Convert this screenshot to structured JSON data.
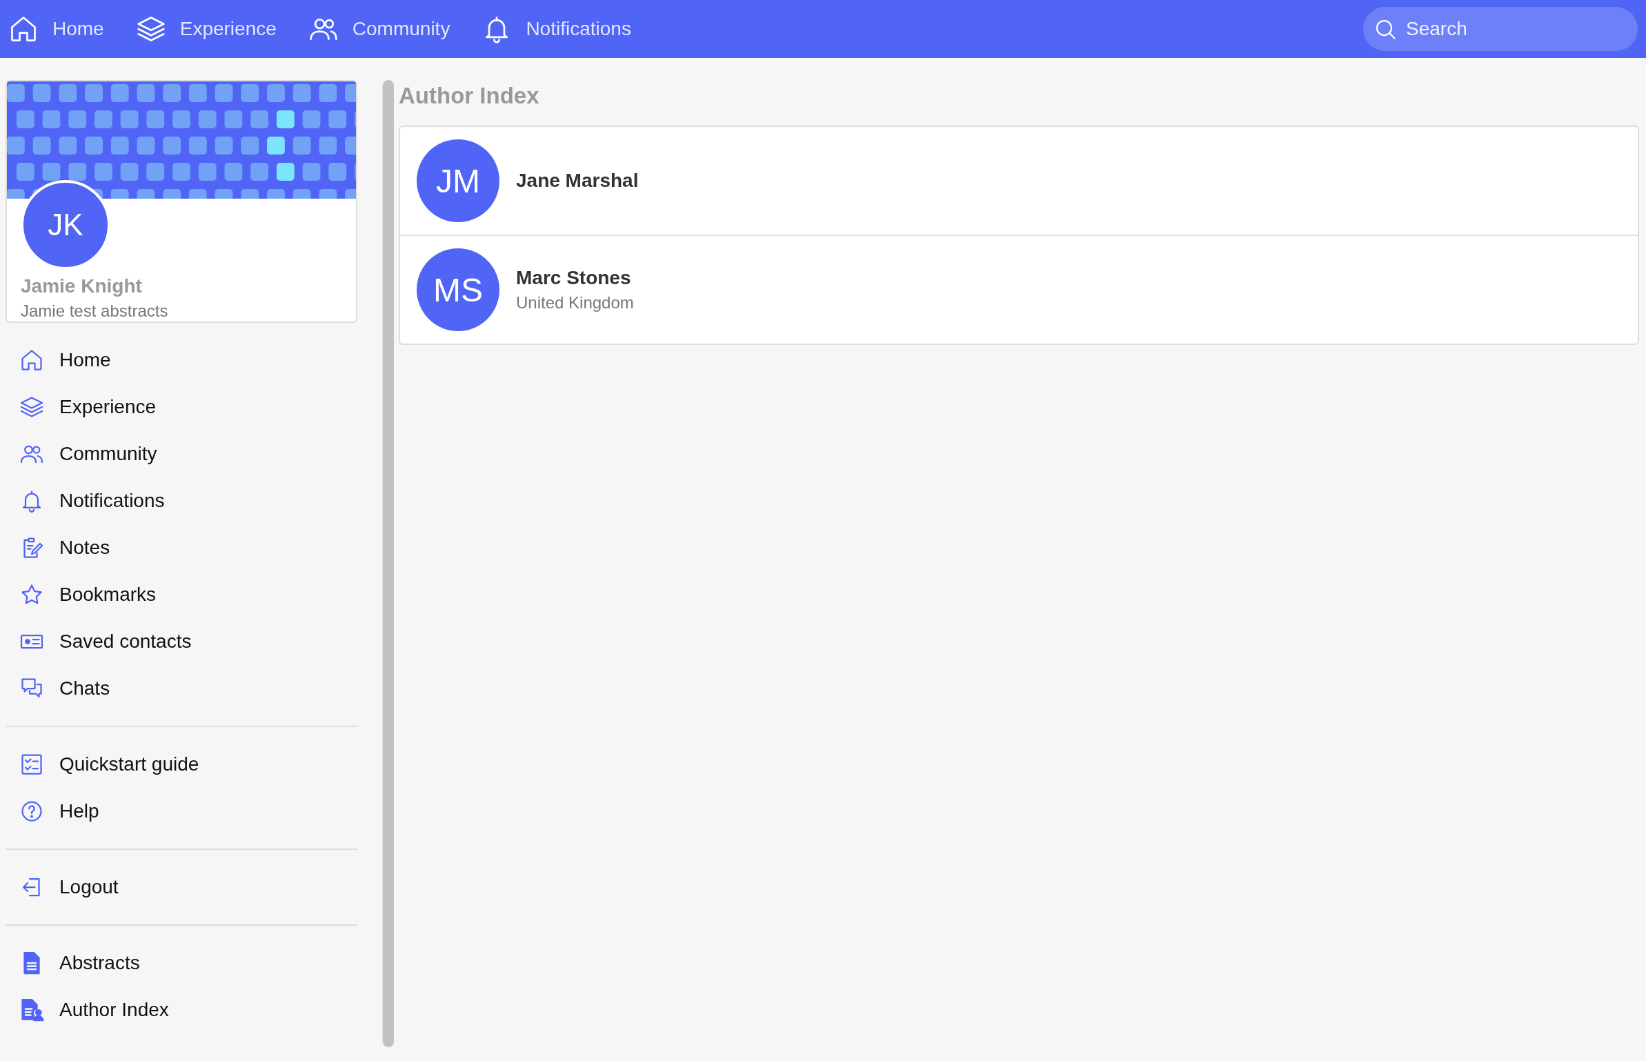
{
  "top_nav": {
    "items": [
      {
        "label": "Home"
      },
      {
        "label": "Experience"
      },
      {
        "label": "Community"
      },
      {
        "label": "Notifications"
      }
    ]
  },
  "search": {
    "placeholder": "Search"
  },
  "profile": {
    "initials": "JK",
    "name": "Jamie Knight",
    "subtitle": "Jamie test abstracts"
  },
  "sidebar": {
    "groups": [
      {
        "items": [
          {
            "label": "Home"
          },
          {
            "label": "Experience"
          },
          {
            "label": "Community"
          },
          {
            "label": "Notifications"
          },
          {
            "label": "Notes"
          },
          {
            "label": "Bookmarks"
          },
          {
            "label": "Saved contacts"
          },
          {
            "label": "Chats"
          }
        ]
      },
      {
        "items": [
          {
            "label": "Quickstart guide"
          },
          {
            "label": "Help"
          }
        ]
      },
      {
        "items": [
          {
            "label": "Logout"
          }
        ]
      },
      {
        "items": [
          {
            "label": "Abstracts"
          },
          {
            "label": "Author Index"
          }
        ]
      }
    ]
  },
  "main": {
    "title": "Author Index",
    "authors": [
      {
        "initials": "JM",
        "name": "Jane Marshal"
      },
      {
        "initials": "MS",
        "name": "Marc Stones",
        "country": "United Kingdom"
      }
    ]
  }
}
